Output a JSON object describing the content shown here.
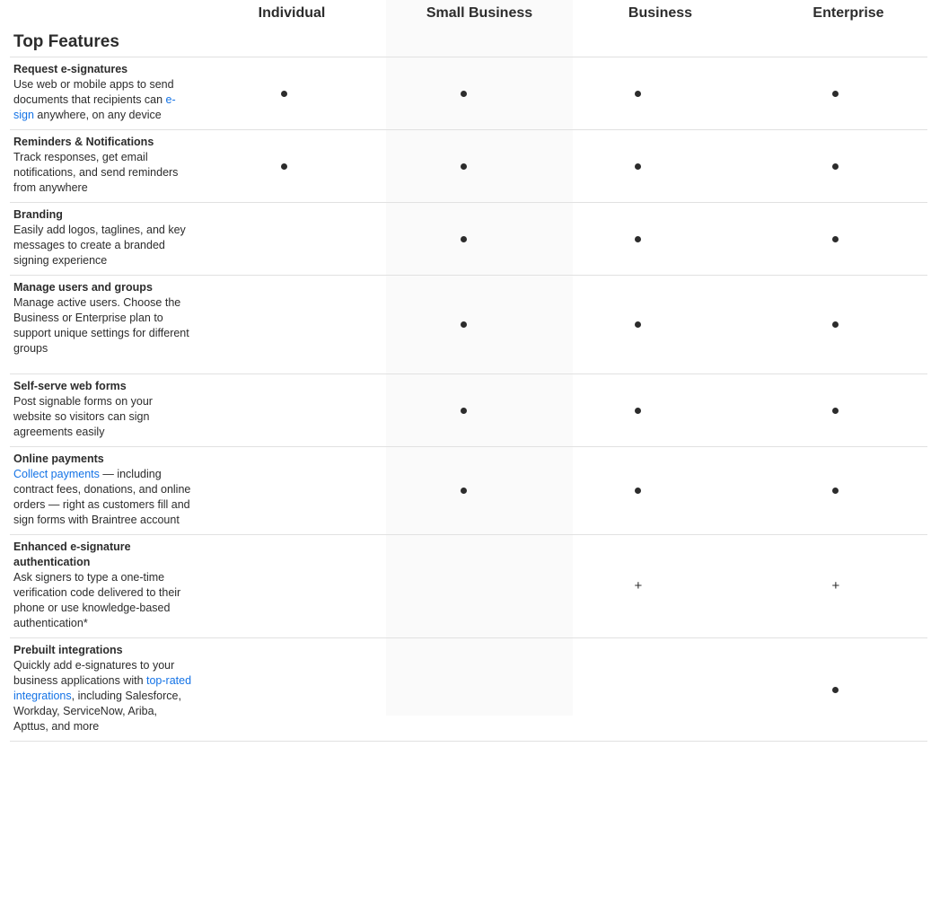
{
  "plans": [
    "Individual",
    "Small Business",
    "Business",
    "Enterprise"
  ],
  "section_title": "Top Features",
  "rows": [
    {
      "name": "Request e-signatures",
      "desc": [
        {
          "t": "Use web or mobile apps to send documents that recipients can "
        },
        {
          "t": "e-sign",
          "link": true
        },
        {
          "t": " anywhere, on any device"
        }
      ],
      "cells": [
        "dot",
        "dot",
        "dot",
        "dot"
      ]
    },
    {
      "name": "Reminders & Notifications",
      "desc": [
        {
          "t": "Track responses, get email notifications, and send reminders from anywhere"
        }
      ],
      "cells": [
        "dot",
        "dot",
        "dot",
        "dot"
      ]
    },
    {
      "name": "Branding",
      "desc": [
        {
          "t": "Easily add logos, taglines, and key messages to create a branded signing experience"
        }
      ],
      "cells": [
        "",
        "dot",
        "dot",
        "dot"
      ]
    },
    {
      "name": "Manage users and groups",
      "desc": [
        {
          "t": "Manage active users. Choose the Business or Enterprise plan to support unique settings for different groups"
        }
      ],
      "cells": [
        "",
        "dot",
        "dot",
        "dot"
      ]
    },
    {
      "name": "Self-serve web forms",
      "desc": [
        {
          "t": "Post signable forms on your website so visitors can sign agreements easily"
        }
      ],
      "cells": [
        "",
        "dot",
        "dot",
        "dot"
      ]
    },
    {
      "name": "Online payments",
      "desc": [
        {
          "t": "Collect payments",
          "link": true
        },
        {
          "t": " — including contract fees, donations, and online orders — right as customers fill and sign forms with Braintree account"
        }
      ],
      "cells": [
        "",
        "dot",
        "dot",
        "dot"
      ]
    },
    {
      "name": "Enhanced e-signature authentication",
      "desc": [
        {
          "t": "Ask signers to type a one-time verification code delivered to their phone or use knowledge-based authentication*"
        }
      ],
      "cells": [
        "",
        "",
        "plus",
        "plus"
      ]
    },
    {
      "name": "Prebuilt integrations",
      "desc": [
        {
          "t": "Quickly add e-signatures to your business applications with "
        },
        {
          "t": "top-rated integrations",
          "link": true
        },
        {
          "t": ", including Salesforce, Workday, ServiceNow, Ariba, Apttus, and more"
        }
      ],
      "cells": [
        "",
        "",
        "",
        "dot"
      ]
    }
  ],
  "colors": {
    "link": "#1473e6",
    "highlight_column": "#fafafa",
    "text": "#2c2c2c"
  }
}
